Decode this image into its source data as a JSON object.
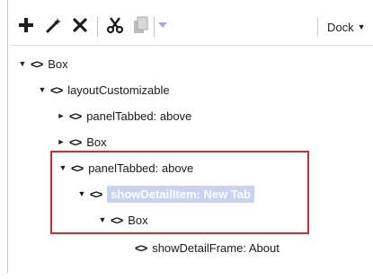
{
  "toolbar": {
    "add_icon": "plus-icon",
    "wand_icon": "wand-icon",
    "delete_icon": "x-icon",
    "cut_icon": "scissors-icon",
    "copy_icon": "copy-icon",
    "dropdown_icon": "chevron-down-icon",
    "dock_label": "Dock"
  },
  "tree": {
    "nodes": [
      {
        "label": "Box",
        "toggle": "▼"
      },
      {
        "label": "layoutCustomizable",
        "toggle": "▼"
      },
      {
        "label": "panelTabbed: above",
        "toggle": "►"
      },
      {
        "label": "Box",
        "toggle": "►"
      },
      {
        "label": "panelTabbed: above",
        "toggle": "▼"
      },
      {
        "label": "showDetailItem: New Tab",
        "toggle": "▼"
      },
      {
        "label": "Box",
        "toggle": "▼"
      },
      {
        "label": "showDetailFrame: About",
        "toggle": ""
      }
    ]
  }
}
